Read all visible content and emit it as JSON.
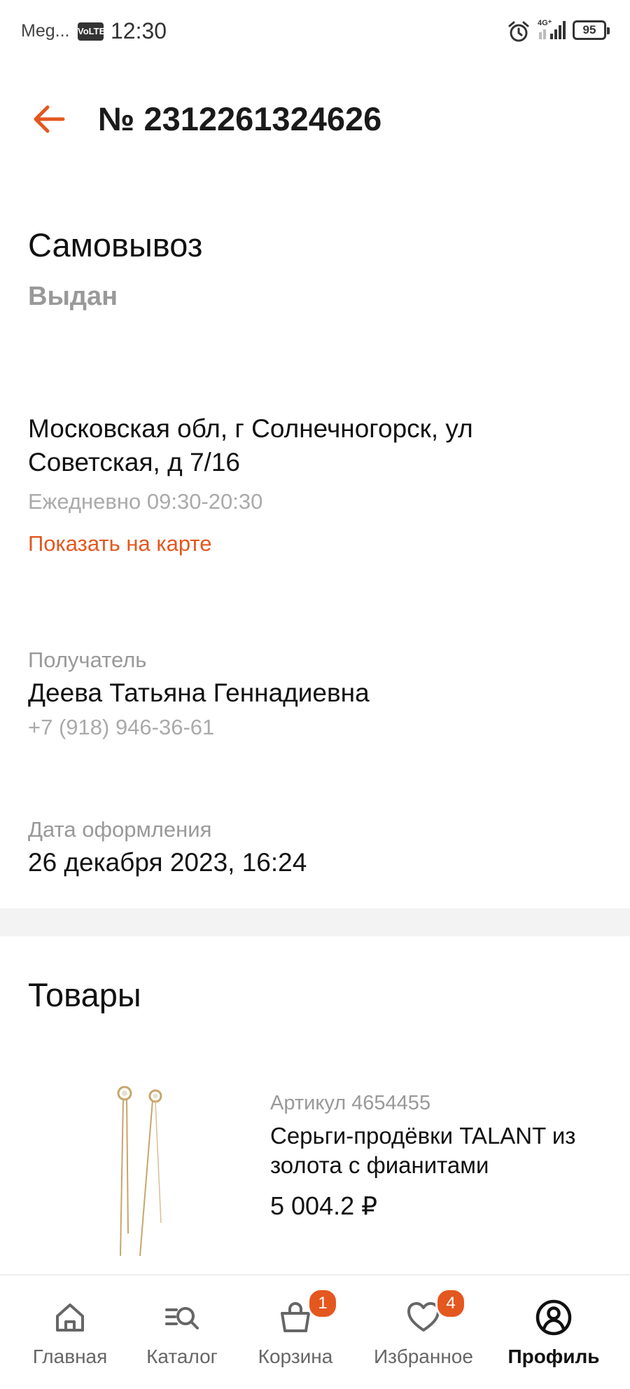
{
  "status_bar": {
    "carrier": "Meg...",
    "volte": "VoLTE",
    "time": "12:30",
    "network": "4G⁺",
    "battery": "95"
  },
  "header": {
    "order_number": "№ 2312261324626"
  },
  "delivery": {
    "type": "Самовывоз",
    "status": "Выдан"
  },
  "pickup_point": {
    "address": "Московская обл, г Солнечногорск, ул Советская, д 7/16",
    "hours": "Ежедневно 09:30-20:30",
    "map_link": "Показать на карте"
  },
  "recipient": {
    "label": "Получатель",
    "name": "Деева Татьяна Геннадиевна",
    "phone": "+7 (918) 946-36-61"
  },
  "order_date": {
    "label": "Дата оформления",
    "value": "26 декабря 2023, 16:24"
  },
  "products": {
    "title": "Товары",
    "items": [
      {
        "sku": "Артикул 4654455",
        "name": "Серьги-продёвки TALANT из золота с фианитами",
        "price": "5 004.2 ₽"
      }
    ]
  },
  "bottom_nav": {
    "items": [
      {
        "label": "Главная",
        "icon": "home-icon",
        "badge": ""
      },
      {
        "label": "Каталог",
        "icon": "catalog-search-icon",
        "badge": ""
      },
      {
        "label": "Корзина",
        "icon": "cart-icon",
        "badge": "1"
      },
      {
        "label": "Избранное",
        "icon": "heart-icon",
        "badge": "4"
      },
      {
        "label": "Профиль",
        "icon": "profile-icon",
        "badge": ""
      }
    ],
    "active": "Профиль"
  },
  "colors": {
    "accent": "#e4571f",
    "text_primary": "#111111",
    "text_secondary": "#999999",
    "divider": "#f3f3f3"
  }
}
